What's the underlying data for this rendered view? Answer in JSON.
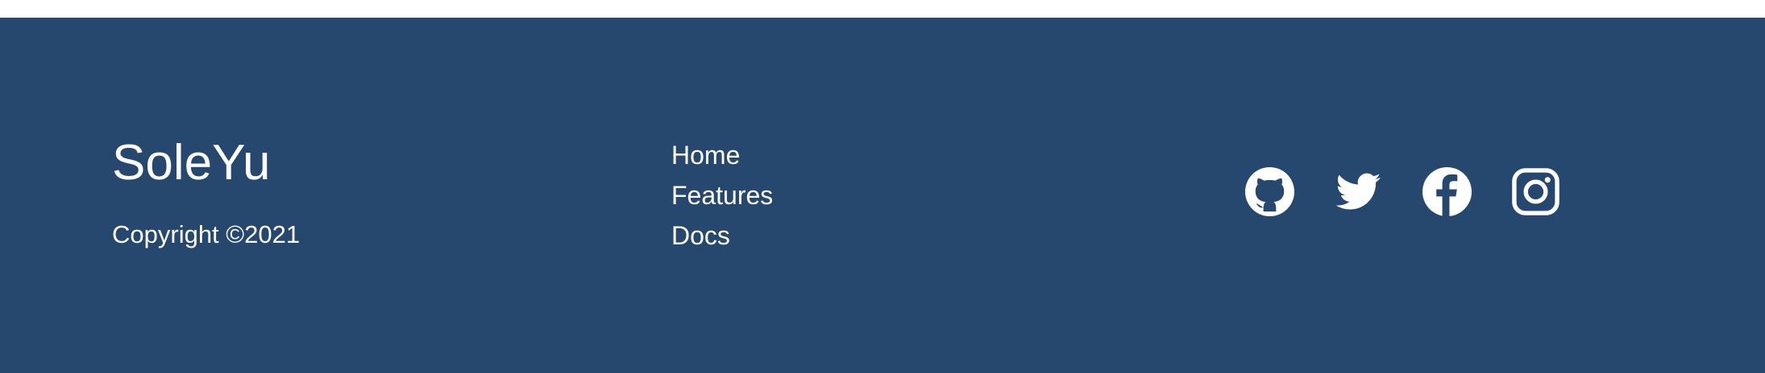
{
  "footer": {
    "background_color": "#26476e",
    "text_color": "#ffffff",
    "brand": "SoleYu",
    "copyright": "Copyright ©2021",
    "nav": {
      "items": [
        {
          "label": "Home"
        },
        {
          "label": "Features"
        },
        {
          "label": "Docs"
        }
      ]
    },
    "social": {
      "items": [
        {
          "icon": "github-icon"
        },
        {
          "icon": "twitter-icon"
        },
        {
          "icon": "facebook-icon"
        },
        {
          "icon": "instagram-icon"
        }
      ]
    }
  }
}
